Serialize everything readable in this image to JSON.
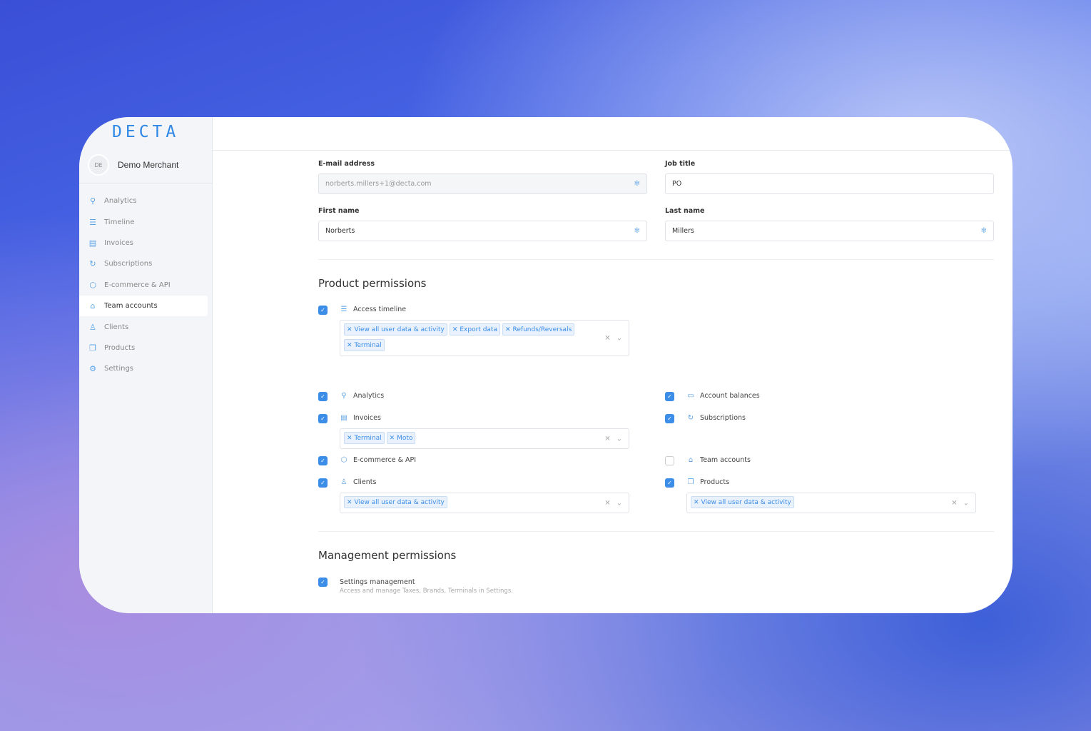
{
  "brand": {
    "logo": "DECTA",
    "merchant_initials": "DE",
    "merchant_name": "Demo Merchant",
    "accent": "#3b8de8"
  },
  "sidebar": {
    "items": [
      {
        "label": "Analytics",
        "icon": "search-icon"
      },
      {
        "label": "Timeline",
        "icon": "list-icon"
      },
      {
        "label": "Invoices",
        "icon": "document-icon"
      },
      {
        "label": "Subscriptions",
        "icon": "refresh-icon"
      },
      {
        "label": "E-commerce & API",
        "icon": "cube-icon"
      },
      {
        "label": "Team accounts",
        "icon": "team-icon",
        "active": true
      },
      {
        "label": "Clients",
        "icon": "user-icon"
      },
      {
        "label": "Products",
        "icon": "box-icon"
      },
      {
        "label": "Settings",
        "icon": "gear-icon"
      }
    ]
  },
  "form": {
    "email": {
      "label": "E-mail address",
      "value": "norberts.millers+1@decta.com"
    },
    "job_title": {
      "label": "Job title",
      "value": "PO"
    },
    "first_name": {
      "label": "First name",
      "value": "Norberts"
    },
    "last_name": {
      "label": "Last name",
      "value": "Millers"
    }
  },
  "product_permissions": {
    "title": "Product permissions",
    "access_timeline": {
      "label": "Access timeline",
      "checked": true,
      "tags": [
        "View all user data & activity",
        "Export data",
        "Refunds/Reversals",
        "Terminal"
      ]
    },
    "analytics": {
      "label": "Analytics",
      "checked": true
    },
    "account_balances": {
      "label": "Account balances",
      "checked": true
    },
    "invoices": {
      "label": "Invoices",
      "checked": true,
      "tags": [
        "Terminal",
        "Moto"
      ]
    },
    "subscriptions": {
      "label": "Subscriptions",
      "checked": true
    },
    "ecommerce": {
      "label": "E-commerce & API",
      "checked": true
    },
    "team_accounts": {
      "label": "Team accounts",
      "checked": false
    },
    "clients": {
      "label": "Clients",
      "checked": true,
      "tags": [
        "View all user data & activity"
      ]
    },
    "products": {
      "label": "Products",
      "checked": true,
      "tags": [
        "View all user data & activity"
      ]
    }
  },
  "management_permissions": {
    "title": "Management permissions",
    "settings": {
      "label": "Settings management",
      "description": "Access and manage Taxes, Brands, Terminals in Settings.",
      "checked": true
    }
  }
}
